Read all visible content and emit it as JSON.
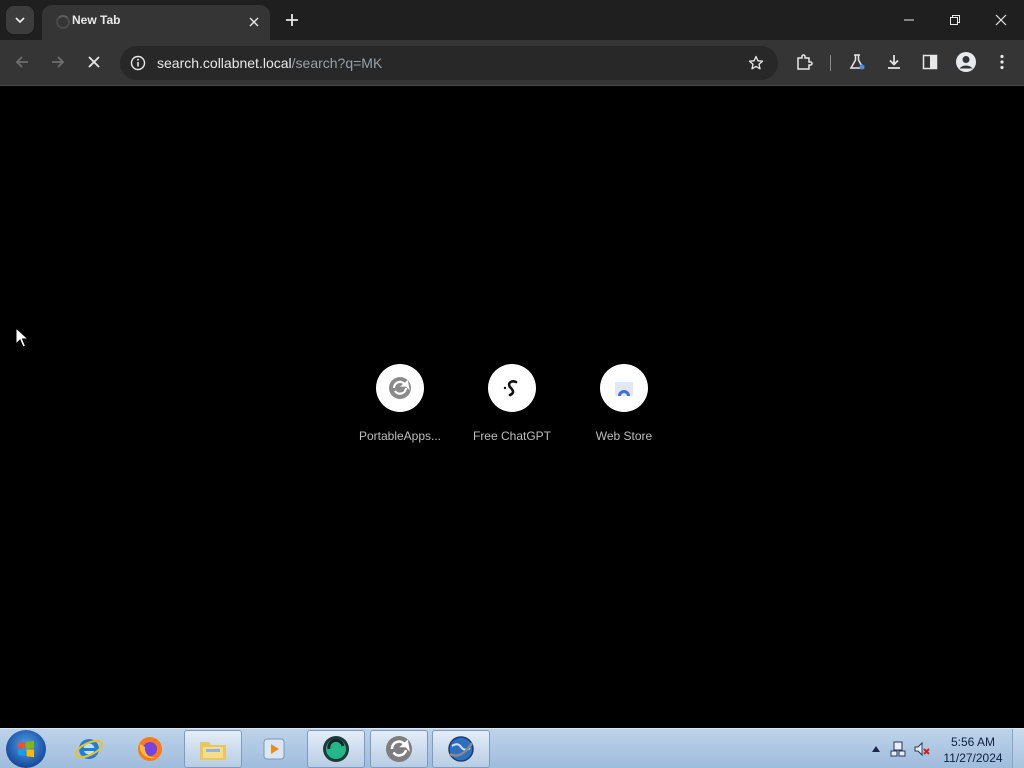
{
  "browser": {
    "tab": {
      "title": "New Tab"
    },
    "toolbar": {
      "url_host": "search.collabnet.local",
      "url_path": "/search?q=MK"
    }
  },
  "new_tab": {
    "shortcuts": [
      {
        "label": "PortableApps...",
        "icon": "portableapps-icon"
      },
      {
        "label": "Free ChatGPT",
        "icon": "chatgpt-icon"
      },
      {
        "label": "Web Store",
        "icon": "webstore-icon"
      }
    ]
  },
  "taskbar": {
    "apps": [
      "internet-explorer-icon",
      "firefox-icon",
      "file-explorer-icon",
      "media-player-icon",
      "app-green-icon",
      "portableapps-icon",
      "browser-globe-icon"
    ],
    "clock": {
      "time": "5:56 AM",
      "date": "11/27/2024"
    }
  },
  "colors": {
    "titlebar": "#1f1f1f",
    "toolbar": "#353535",
    "omnibox": "#282828",
    "content_bg": "#000000",
    "taskbar": "#9fbcdc"
  }
}
